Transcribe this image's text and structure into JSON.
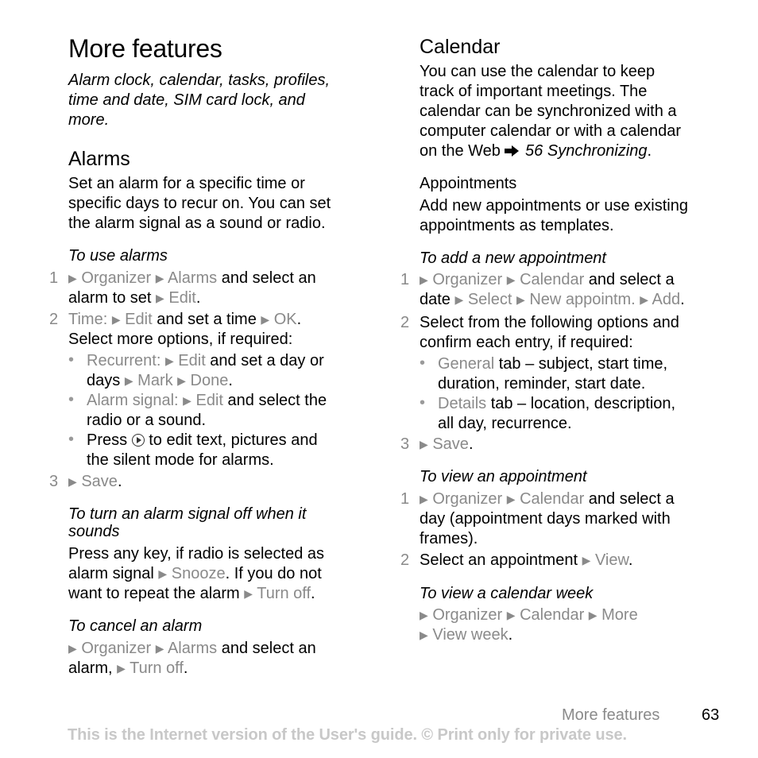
{
  "page": {
    "title": "More features",
    "intro": [
      "Alarm clock, calendar, tasks, profiles,",
      "time and date, SIM card lock, and",
      "more."
    ],
    "footer_section": "More features",
    "page_number": "63",
    "notice": "This is the Internet version of the User's guide. © Print only for private use."
  },
  "alarms": {
    "heading": "Alarms",
    "body": [
      "Set an alarm for a specific time or",
      "specific days to recur on. You can set",
      "the alarm signal as a sound or radio."
    ],
    "use": {
      "title": "To use alarms",
      "step1_num": "1",
      "step1_a": "Organizer",
      "step1_b": "Alarms",
      "step1_c": " and select an",
      "step1_d": "alarm to set ",
      "step1_e": "Edit",
      "step1_f": ".",
      "step2_num": "2",
      "step2_a": "Time:",
      "step2_b": "Edit",
      "step2_c": " and set a time ",
      "step2_d": "OK",
      "step2_e": ".",
      "step2_line2": "Select more options, if required:",
      "b1_a": "Recurrent:",
      "b1_b": "Edit",
      "b1_c": " and set a day or",
      "b1_d": "days ",
      "b1_e": "Mark",
      "b1_f": "Done",
      "b1_g": ".",
      "b2_a": "Alarm signal:",
      "b2_b": "Edit",
      "b2_c": " and select the",
      "b2_d": "radio or a sound.",
      "b3_a": "Press ",
      "b3_b": " to edit text, pictures and",
      "b3_c": "the silent mode for alarms.",
      "step3_num": "3",
      "step3_a": "Save",
      "step3_b": "."
    },
    "off": {
      "title": [
        "To turn an alarm signal off when it",
        "sounds"
      ],
      "l1": "Press any key, if radio is selected as",
      "l2_a": "alarm signal ",
      "l2_b": "Snooze",
      "l2_c": ". If you do not",
      "l3_a": "want to repeat the alarm ",
      "l3_b": "Turn off",
      "l3_c": "."
    },
    "cancel": {
      "title": "To cancel an alarm",
      "l1_a": "Organizer",
      "l1_b": "Alarms",
      "l1_c": " and select an",
      "l2_a": "alarm, ",
      "l2_b": "Turn off",
      "l2_c": "."
    }
  },
  "calendar": {
    "heading": "Calendar",
    "body": [
      "You can use the calendar to keep",
      "track of important meetings. The",
      "calendar can be synchronized with a",
      "computer calendar or with a calendar"
    ],
    "body_last_a": "on the Web ",
    "body_last_ref": "56 Synchronizing",
    "body_last_b": ".",
    "appointments": {
      "heading": "Appointments",
      "body": [
        "Add new appointments or use existing",
        "appointments as templates."
      ]
    },
    "add": {
      "title": "To add a new appointment",
      "step1_num": "1",
      "s1_a": "Organizer",
      "s1_b": "Calendar",
      "s1_c": " and select a",
      "s1_d": "date ",
      "s1_e": "Select",
      "s1_f": "New appointm.",
      "s1_g": "Add",
      "s1_h": ".",
      "step2_num": "2",
      "s2_l1": "Select from the following options and",
      "s2_l2": "confirm each entry, if required:",
      "b1_a": "General",
      "b1_b": " tab – subject, start time,",
      "b1_c": "duration, reminder, start date.",
      "b2_a": "Details",
      "b2_b": " tab – location, description,",
      "b2_c": "all day, recurrence.",
      "step3_num": "3",
      "s3_a": "Save",
      "s3_b": "."
    },
    "view": {
      "title": "To view an appointment",
      "step1_num": "1",
      "s1_a": "Organizer",
      "s1_b": "Calendar",
      "s1_c": " and select a",
      "s1_l2": "day (appointment days marked with",
      "s1_l3": "frames).",
      "step2_num": "2",
      "s2_a": "Select an appointment ",
      "s2_b": "View",
      "s2_c": "."
    },
    "week": {
      "title": "To view a calendar week",
      "a": "Organizer",
      "b": "Calendar",
      "c": "More",
      "d": "View week",
      "e": "."
    }
  }
}
